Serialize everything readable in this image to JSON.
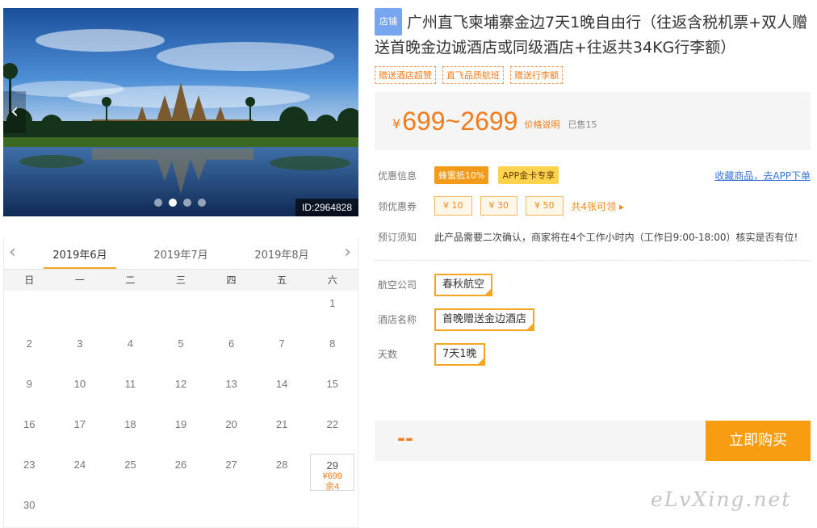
{
  "hero": {
    "image_id": "ID:2964828",
    "dots": 4,
    "active_dot": 1,
    "prev_icon": "chevron-left-icon",
    "next_icon": "chevron-right-icon"
  },
  "calendar": {
    "months": [
      "2019年6月",
      "2019年7月",
      "2019年8月"
    ],
    "active_month": 0,
    "weekdays": [
      "日",
      "一",
      "二",
      "三",
      "四",
      "五",
      "六"
    ],
    "days": [
      [
        "",
        "",
        "",
        "",
        "",
        "",
        "1"
      ],
      [
        "2",
        "3",
        "4",
        "5",
        "6",
        "7",
        "8"
      ],
      [
        "9",
        "10",
        "11",
        "12",
        "13",
        "14",
        "15"
      ],
      [
        "16",
        "17",
        "18",
        "19",
        "20",
        "21",
        "22"
      ],
      [
        "23",
        "24",
        "25",
        "26",
        "27",
        "28",
        "29"
      ],
      [
        "30",
        "",
        "",
        "",
        "",
        "",
        ""
      ]
    ],
    "available": {
      "day": "29",
      "price": "¥699",
      "left": "余4"
    },
    "accent_color": "#f6a623"
  },
  "product": {
    "shop_tag": "店铺",
    "title": "广州直飞柬埔寨金边7天1晚自由行（往返含税机票+双人赠送首晚金边诚酒店或同级酒店+往返共34KG行李额）",
    "tags": [
      "赠送酒店超赞",
      "直飞品质航班",
      "赠送行李额"
    ],
    "price": {
      "currency": "¥",
      "value": "699~2699",
      "desc": "价格说明",
      "sold": "已售15"
    },
    "discount": {
      "label": "优惠信息",
      "badge1": "蜂蜜抵10%",
      "badge2": "APP金卡专享",
      "link": "收藏商品，去APP下单"
    },
    "coupons": {
      "label": "领优惠券",
      "items": [
        "¥ 10",
        "¥ 30",
        "¥ 50"
      ],
      "more": "共4张可领 ▸"
    },
    "notice": {
      "label": "预订须知",
      "text": "此产品需要二次确认，商家将在4个工作小时内（工作日9:00-18:00）核实是否有位!"
    },
    "options": [
      {
        "label": "航空公司",
        "value": "春秋航空"
      },
      {
        "label": "酒店名称",
        "value": "首晚赠送金边酒店"
      },
      {
        "label": "天数",
        "value": "7天1晚"
      }
    ],
    "buy": {
      "dash": "--",
      "button": "立即购买"
    },
    "price_color": "#f27b1b"
  },
  "watermark": "eLvXing.net"
}
